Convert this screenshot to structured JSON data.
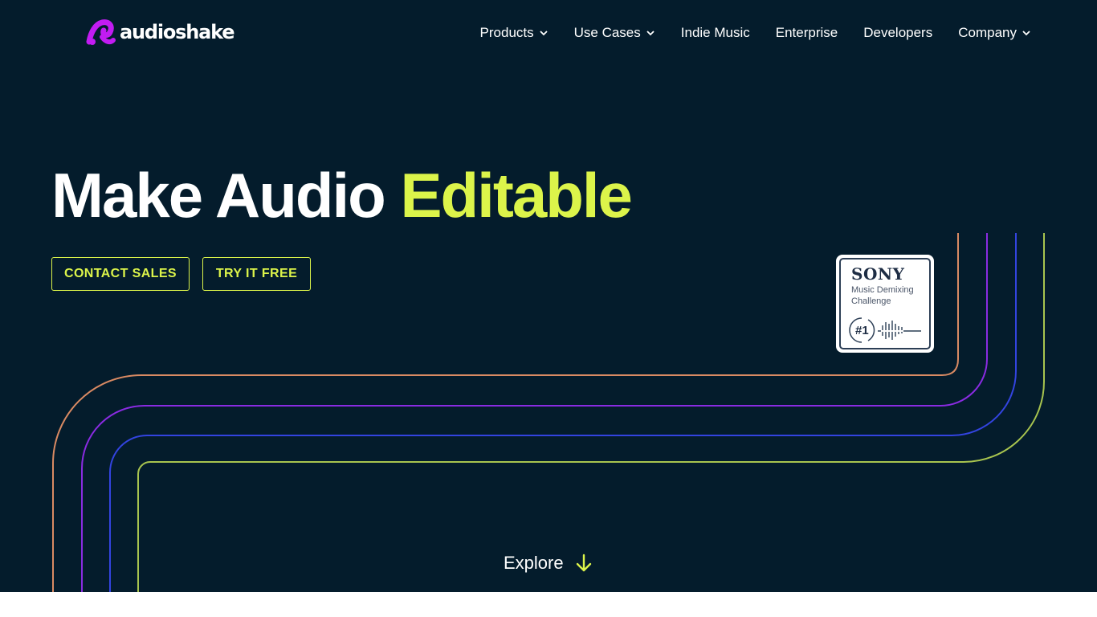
{
  "brand": {
    "name": "audioshake",
    "logo_color": "#c21cf2"
  },
  "nav": {
    "items": [
      {
        "label": "Products",
        "has_dropdown": true
      },
      {
        "label": "Use Cases",
        "has_dropdown": true
      },
      {
        "label": "Indie Music",
        "has_dropdown": false
      },
      {
        "label": "Enterprise",
        "has_dropdown": false
      },
      {
        "label": "Developers",
        "has_dropdown": false
      },
      {
        "label": "Company",
        "has_dropdown": true
      }
    ]
  },
  "hero": {
    "title_main": "Make Audio ",
    "title_accent": "Editable",
    "accent_color": "#dcf44a"
  },
  "buttons": {
    "contact_label": "CONTACT SALES",
    "try_label": "TRY IT FREE"
  },
  "badge": {
    "brand": "SONY",
    "line1": "Music Demixing",
    "line2": "Challenge",
    "rank": "#1"
  },
  "explore": {
    "label": "Explore",
    "icon": "arrow-down-icon"
  },
  "colors": {
    "background": "#041c2c",
    "line_orange": "#d98a63",
    "line_purple": "#8a2be2",
    "line_blue": "#3344e0",
    "line_green": "#a8c44f"
  }
}
